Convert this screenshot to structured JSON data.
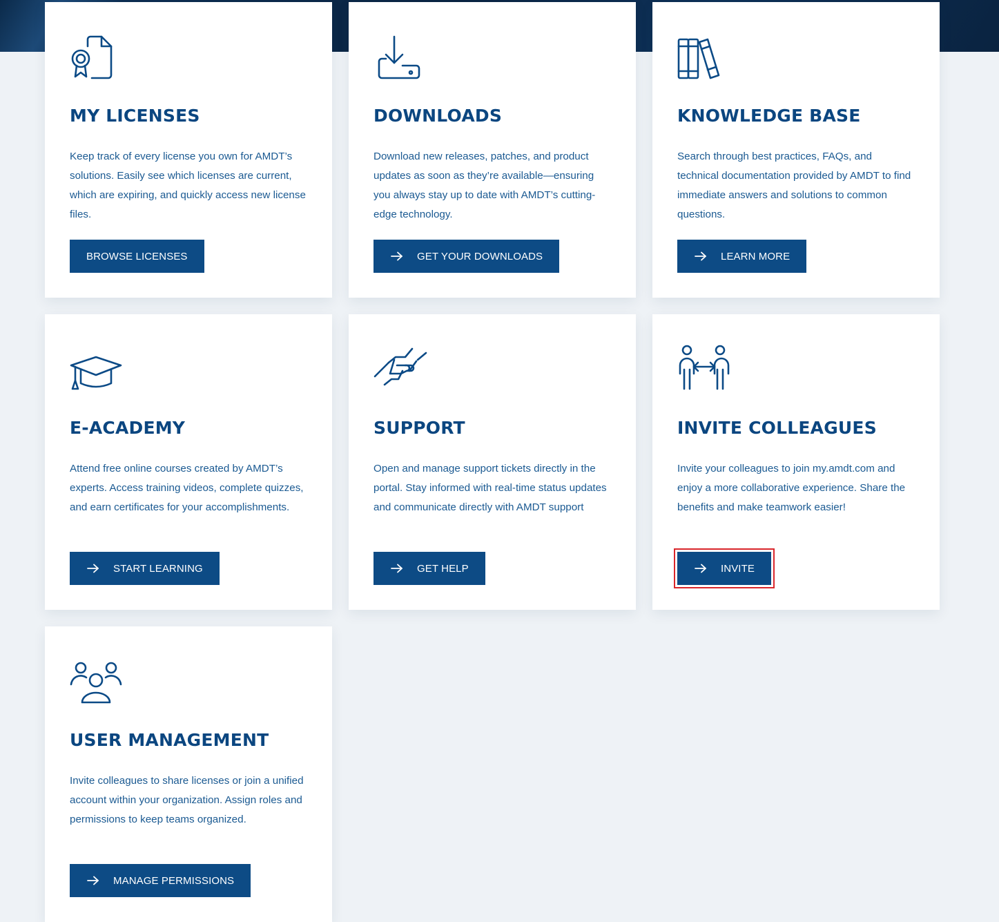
{
  "cards": [
    {
      "title": "MY LICENSES",
      "description": "Keep track of every license you own for AMDT’s solutions. Easily see which licenses are current, which are expiring, and quickly access new license files.",
      "button": "BROWSE LICENSES",
      "icon": "license-certificate-icon"
    },
    {
      "title": "DOWNLOADS",
      "description": "Download new releases, patches, and product updates as soon as they’re available—ensuring you always stay up to date with AMDT’s cutting-edge technology.",
      "button": "GET YOUR DOWNLOADS",
      "icon": "download-icon"
    },
    {
      "title": "KNOWLEDGE BASE",
      "description": "Search through best practices, FAQs, and technical documentation provided by AMDT to find immediate answers and solutions to common questions.",
      "button": "LEARN MORE",
      "icon": "books-icon"
    },
    {
      "title": "E-ACADEMY",
      "description": "Attend free online courses created by AMDT’s experts. Access training videos, complete quizzes, and earn certificates for your accomplishments.",
      "button": "START LEARNING",
      "icon": "graduation-cap-icon"
    },
    {
      "title": "SUPPORT",
      "description": "Open and manage support tickets directly in the portal. Stay informed with real-time status updates and communicate directly with AMDT support",
      "button": "GET HELP",
      "icon": "handshake-icon"
    },
    {
      "title": "INVITE COLLEAGUES",
      "description": "Invite your colleagues to join my.amdt.com and enjoy a more collaborative experience. Share the benefits and make teamwork easier!",
      "button": "INVITE",
      "icon": "people-exchange-icon"
    },
    {
      "title": "USER MANAGEMENT",
      "description": "Invite colleagues to share licenses or join a unified account within your organization. Assign roles and permissions to keep teams organized.",
      "button": "MANAGE PERMISSIONS",
      "icon": "user-group-icon"
    }
  ],
  "colors": {
    "primary": "#0d4b85",
    "title": "#0b4680",
    "text": "#1b5a92",
    "background": "#eef2f6",
    "highlight": "#d9262b"
  }
}
